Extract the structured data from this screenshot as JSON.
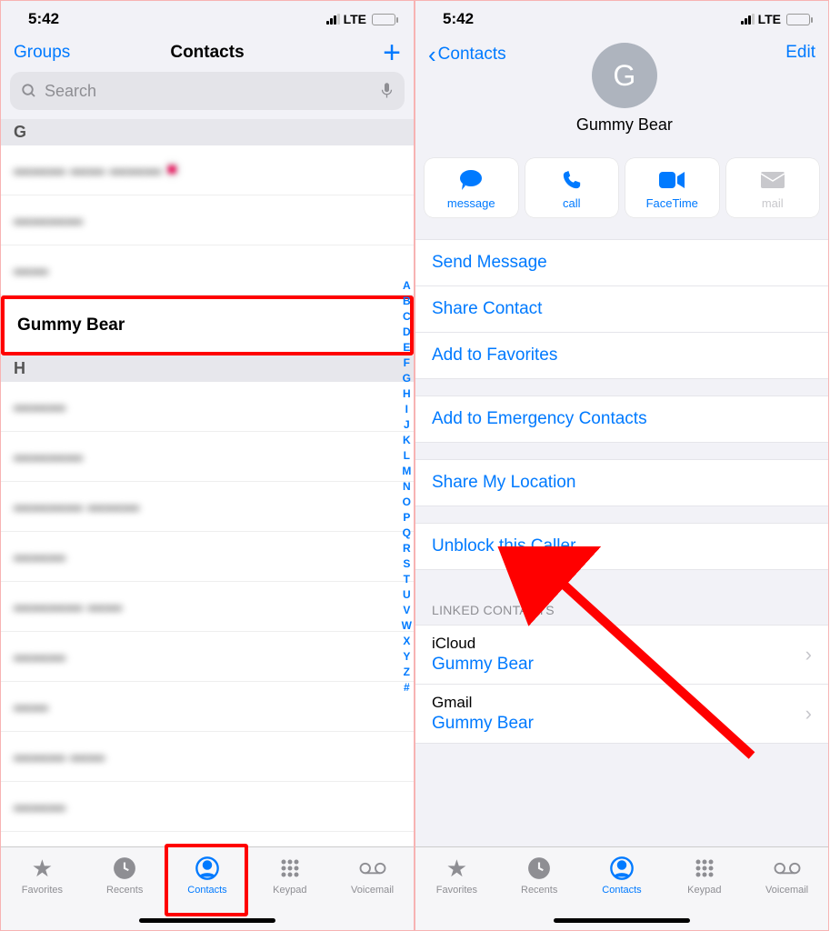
{
  "status": {
    "time": "5:42",
    "network": "LTE"
  },
  "left": {
    "nav": {
      "groups": "Groups",
      "title": "Contacts"
    },
    "search": {
      "placeholder": "Search"
    },
    "sections": {
      "G": {
        "letter": "G",
        "highlight": "Gummy Bear"
      },
      "H": {
        "letter": "H"
      }
    },
    "index": [
      "A",
      "B",
      "C",
      "D",
      "E",
      "F",
      "G",
      "H",
      "I",
      "J",
      "K",
      "L",
      "M",
      "N",
      "O",
      "P",
      "Q",
      "R",
      "S",
      "T",
      "U",
      "V",
      "W",
      "X",
      "Y",
      "Z",
      "#"
    ]
  },
  "right": {
    "nav": {
      "back": "Contacts",
      "edit": "Edit"
    },
    "contact": {
      "initial": "G",
      "name": "Gummy Bear"
    },
    "quick": {
      "message": "message",
      "call": "call",
      "facetime": "FaceTime",
      "mail": "mail"
    },
    "actions": {
      "send_message": "Send Message",
      "share_contact": "Share Contact",
      "add_favorites": "Add to Favorites",
      "add_emergency": "Add to Emergency Contacts",
      "share_location": "Share My Location",
      "unblock": "Unblock this Caller"
    },
    "linked": {
      "header": "LINKED CONTACTS",
      "items": [
        {
          "source": "iCloud",
          "name": "Gummy Bear"
        },
        {
          "source": "Gmail",
          "name": "Gummy Bear"
        }
      ]
    }
  },
  "tabs": {
    "favorites": "Favorites",
    "recents": "Recents",
    "contacts": "Contacts",
    "keypad": "Keypad",
    "voicemail": "Voicemail"
  }
}
